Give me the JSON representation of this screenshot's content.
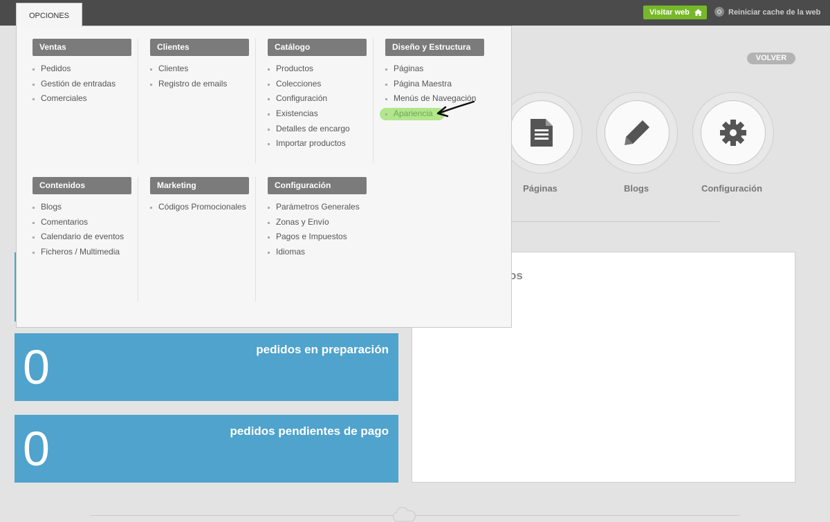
{
  "topbar": {
    "tab_label": "OPCIONES",
    "visit_web_label": "Visitar web",
    "reset_cache_label": "Reiniciar cache de la web"
  },
  "menu": {
    "row1": [
      {
        "header": "Ventas",
        "items": [
          "Pedidos",
          "Gestión de entradas",
          "Comerciales"
        ]
      },
      {
        "header": "Clientes",
        "items": [
          "Clientes",
          "Registro de emails"
        ]
      },
      {
        "header": "Catálogo",
        "items": [
          "Productos",
          "Colecciones",
          "Configuración",
          "Existencias",
          "Detalles de encargo",
          "Importar productos"
        ]
      },
      {
        "header": "Diseño y Estructura",
        "items": [
          "Páginas",
          "Página Maestra",
          "Menús de Navegación",
          "Apariencia"
        ]
      }
    ],
    "row2": [
      {
        "header": "Contenidos",
        "items": [
          "Blogs",
          "Comentarios",
          "Calendario de eventos",
          "Ficheros / Multimedia"
        ]
      },
      {
        "header": "Marketing",
        "items": [
          "Códigos Promocionales"
        ]
      },
      {
        "header": "Configuración",
        "items": [
          "Parámetros Generales",
          "Zonas y Envío",
          "Pagos e Impuestos",
          "Idiomas"
        ]
      }
    ],
    "highlighted_item": "Apariencia"
  },
  "volver_label": "VOLVER",
  "shortcuts": [
    {
      "label": "Páginas",
      "icon": "document-icon"
    },
    {
      "label": "Blogs",
      "icon": "pencil-icon"
    },
    {
      "label": "Configuración",
      "icon": "gear-icon"
    }
  ],
  "stats": [
    {
      "value": "0",
      "label": "pedidos en preparación"
    },
    {
      "value": "0",
      "label": "pedidos pendientes de pago"
    }
  ],
  "panel_title_fragment": "os",
  "colors": {
    "accent_green": "#76b82a",
    "stat_blue": "#4fa3cc",
    "highlight": "#a6e377"
  }
}
